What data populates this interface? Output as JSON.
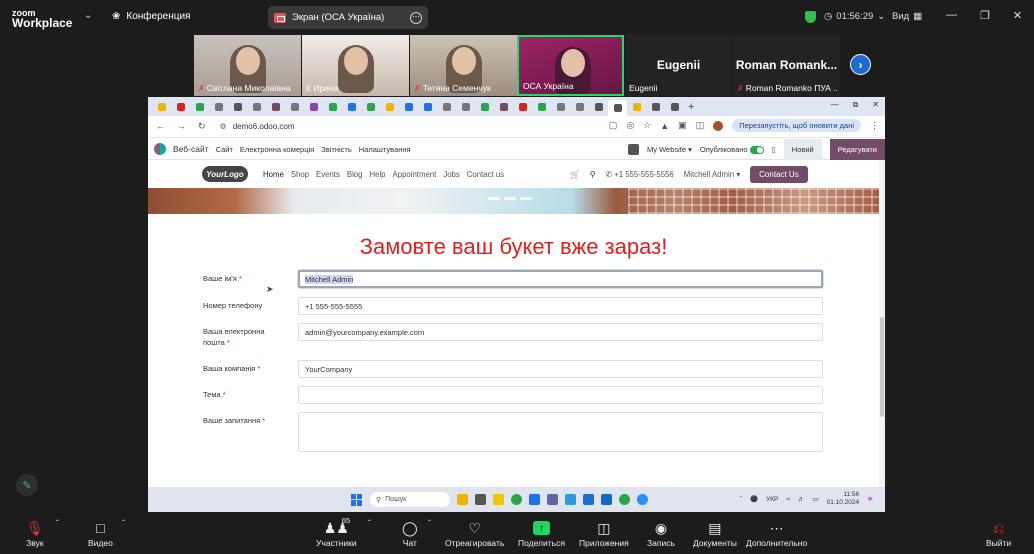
{
  "zoom": {
    "logo_line1": "zoom",
    "logo_line2": "Workplace",
    "conference_label": "Конференция",
    "share_title": "Экран (ОСА Україна)",
    "timer": "01:56:29",
    "view_label": "Вид",
    "participants": [
      {
        "name": "Світлана Миколаївна",
        "muted": true
      },
      {
        "name": "К Ирина",
        "muted": false
      },
      {
        "name": "Тетяна Семенчук",
        "muted": true
      },
      {
        "name": "ОСА Україна",
        "muted": false,
        "active_speaker": true
      },
      {
        "name": "Eugenii",
        "display": "Eugenii",
        "muted": false
      },
      {
        "name": "Roman Romanko ПУА ...",
        "display": "Roman Romank...",
        "muted": true
      }
    ],
    "toolbar": [
      {
        "label": "Звук",
        "icon": "mic-muted-icon"
      },
      {
        "label": "Видео",
        "icon": "camera-icon"
      },
      {
        "label": "Участники",
        "icon": "participants-icon",
        "count": "65"
      },
      {
        "label": "Чат",
        "icon": "chat-icon"
      },
      {
        "label": "Отреагировать",
        "icon": "heart-icon"
      },
      {
        "label": "Поделиться",
        "icon": "share-icon"
      },
      {
        "label": "Приложения",
        "icon": "apps-icon"
      },
      {
        "label": "Запись",
        "icon": "record-icon"
      },
      {
        "label": "Документы",
        "icon": "docs-icon"
      },
      {
        "label": "Дополнительно",
        "icon": "more-icon"
      },
      {
        "label": "Выйти",
        "icon": "leave-icon"
      }
    ],
    "accent": "#1ed760"
  },
  "browser": {
    "url": "demo6.odoo.com",
    "restart_pill": "Перезапустіть, щоб оновити дані",
    "tab_colors": [
      "#f0b400",
      "#e0201f",
      "#2aa54d",
      "#777",
      "#555",
      "#777",
      "#714b67",
      "#777",
      "#8e44ad",
      "#2aa54d",
      "#1a73e8",
      "#2aa54d",
      "#f0b400",
      "#1a73e8",
      "#1a73e8",
      "#777",
      "#777",
      "#2aa54d",
      "#714b67",
      "#e0201f",
      "#2aa54d",
      "#777",
      "#777",
      "#555",
      "#555",
      "#f0b400",
      "#555",
      "#555"
    ],
    "new_tab": "+"
  },
  "odoo": {
    "admin_menu": [
      "Веб-сайт",
      "Сайт",
      "Електронна комерція",
      "Звітність",
      "Налаштування"
    ],
    "website_select": "My Website",
    "published_label": "Опубліковано",
    "new_button": "Новий",
    "edit_button": "Редагувати",
    "logo_text": "YourLogo",
    "site_nav": [
      "Home",
      "Shop",
      "Events",
      "Blog",
      "Help",
      "Appointment",
      "Jobs",
      "Contact us"
    ],
    "phone": "+1 555-555-5556",
    "user": "Mitchell Admin",
    "contact_button": "Contact Us",
    "brand_color": "#714b67"
  },
  "form": {
    "title": "Замовте ваш букет вже зараз!",
    "title_color": "#e0201f",
    "fields": [
      {
        "label": "Ваше ім'я",
        "required": true,
        "value": "Mitchell Admin",
        "focused": true
      },
      {
        "label": "Номер телефону",
        "required": false,
        "value": "+1 555-555-5555"
      },
      {
        "label": "Ваша електронна пошта",
        "required": true,
        "value": "admin@yourcompany.example.com"
      },
      {
        "label": "Ваша компанія",
        "required": true,
        "value": "YourCompany"
      },
      {
        "label": "Тема",
        "required": true,
        "value": ""
      },
      {
        "label": "Ваше запитання",
        "required": true,
        "value": "",
        "multiline": true
      }
    ]
  },
  "taskbar": {
    "search": "Пошук",
    "lang": "УКР",
    "time": "11:56",
    "date": "01.10.2024"
  }
}
